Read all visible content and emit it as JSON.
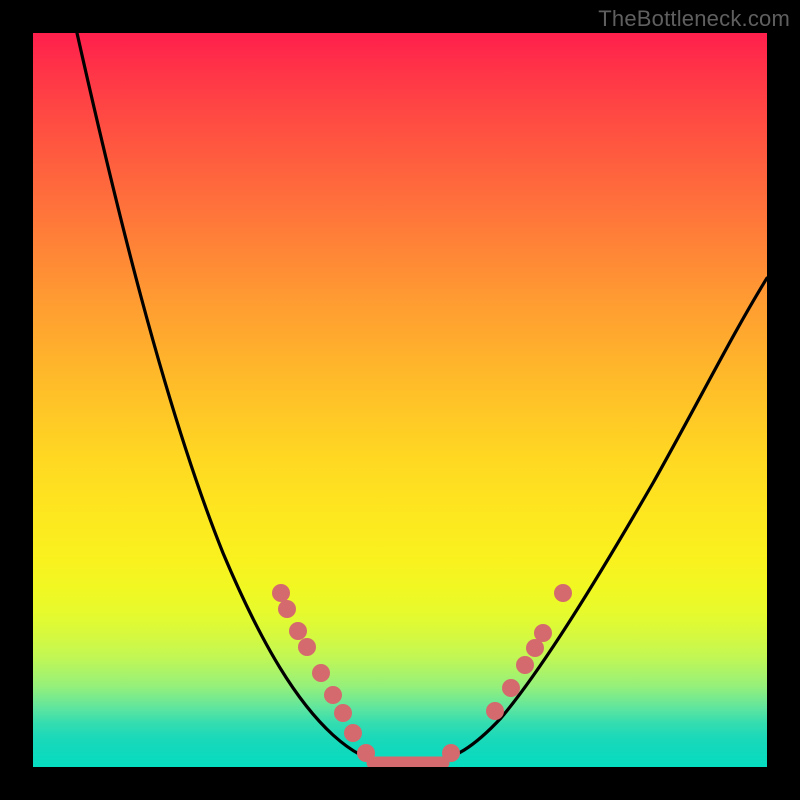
{
  "watermark": "TheBottleneck.com",
  "chart_data": {
    "type": "line",
    "title": "",
    "xlabel": "",
    "ylabel": "",
    "xlim": [
      0,
      100
    ],
    "ylim": [
      0,
      100
    ],
    "grid": false,
    "background_gradient": {
      "direction": "vertical",
      "stops": [
        {
          "pos": 0.0,
          "color": "#ff1f4c"
        },
        {
          "pos": 0.5,
          "color": "#ffd322"
        },
        {
          "pos": 0.95,
          "color": "#1bd9b9"
        },
        {
          "pos": 1.0,
          "color": "#06ddc0"
        }
      ]
    },
    "series": [
      {
        "name": "left-curve",
        "color": "#000000",
        "x": [
          6,
          12,
          18,
          24,
          30,
          36,
          42,
          47
        ],
        "y": [
          100,
          78,
          50,
          29,
          17,
          10,
          4,
          1
        ]
      },
      {
        "name": "right-curve",
        "color": "#000000",
        "x": [
          55,
          60,
          66,
          72,
          80,
          90,
          100
        ],
        "y": [
          1,
          4,
          10,
          20,
          35,
          55,
          67
        ]
      },
      {
        "name": "flat-bottom",
        "color": "#d46a6e",
        "x": [
          46,
          56
        ],
        "y": [
          0.5,
          0.5
        ]
      }
    ],
    "scatter": [
      {
        "name": "left-dots",
        "color": "#d46a6e",
        "x": [
          34,
          35,
          36,
          37,
          39,
          41,
          42,
          44,
          45
        ],
        "y": [
          24,
          22,
          19,
          17,
          13,
          10,
          8,
          5,
          2
        ]
      },
      {
        "name": "right-dots",
        "color": "#d46a6e",
        "x": [
          57,
          63,
          65,
          67,
          68,
          69,
          72
        ],
        "y": [
          2,
          8,
          11,
          14,
          16,
          19,
          24
        ]
      }
    ]
  }
}
